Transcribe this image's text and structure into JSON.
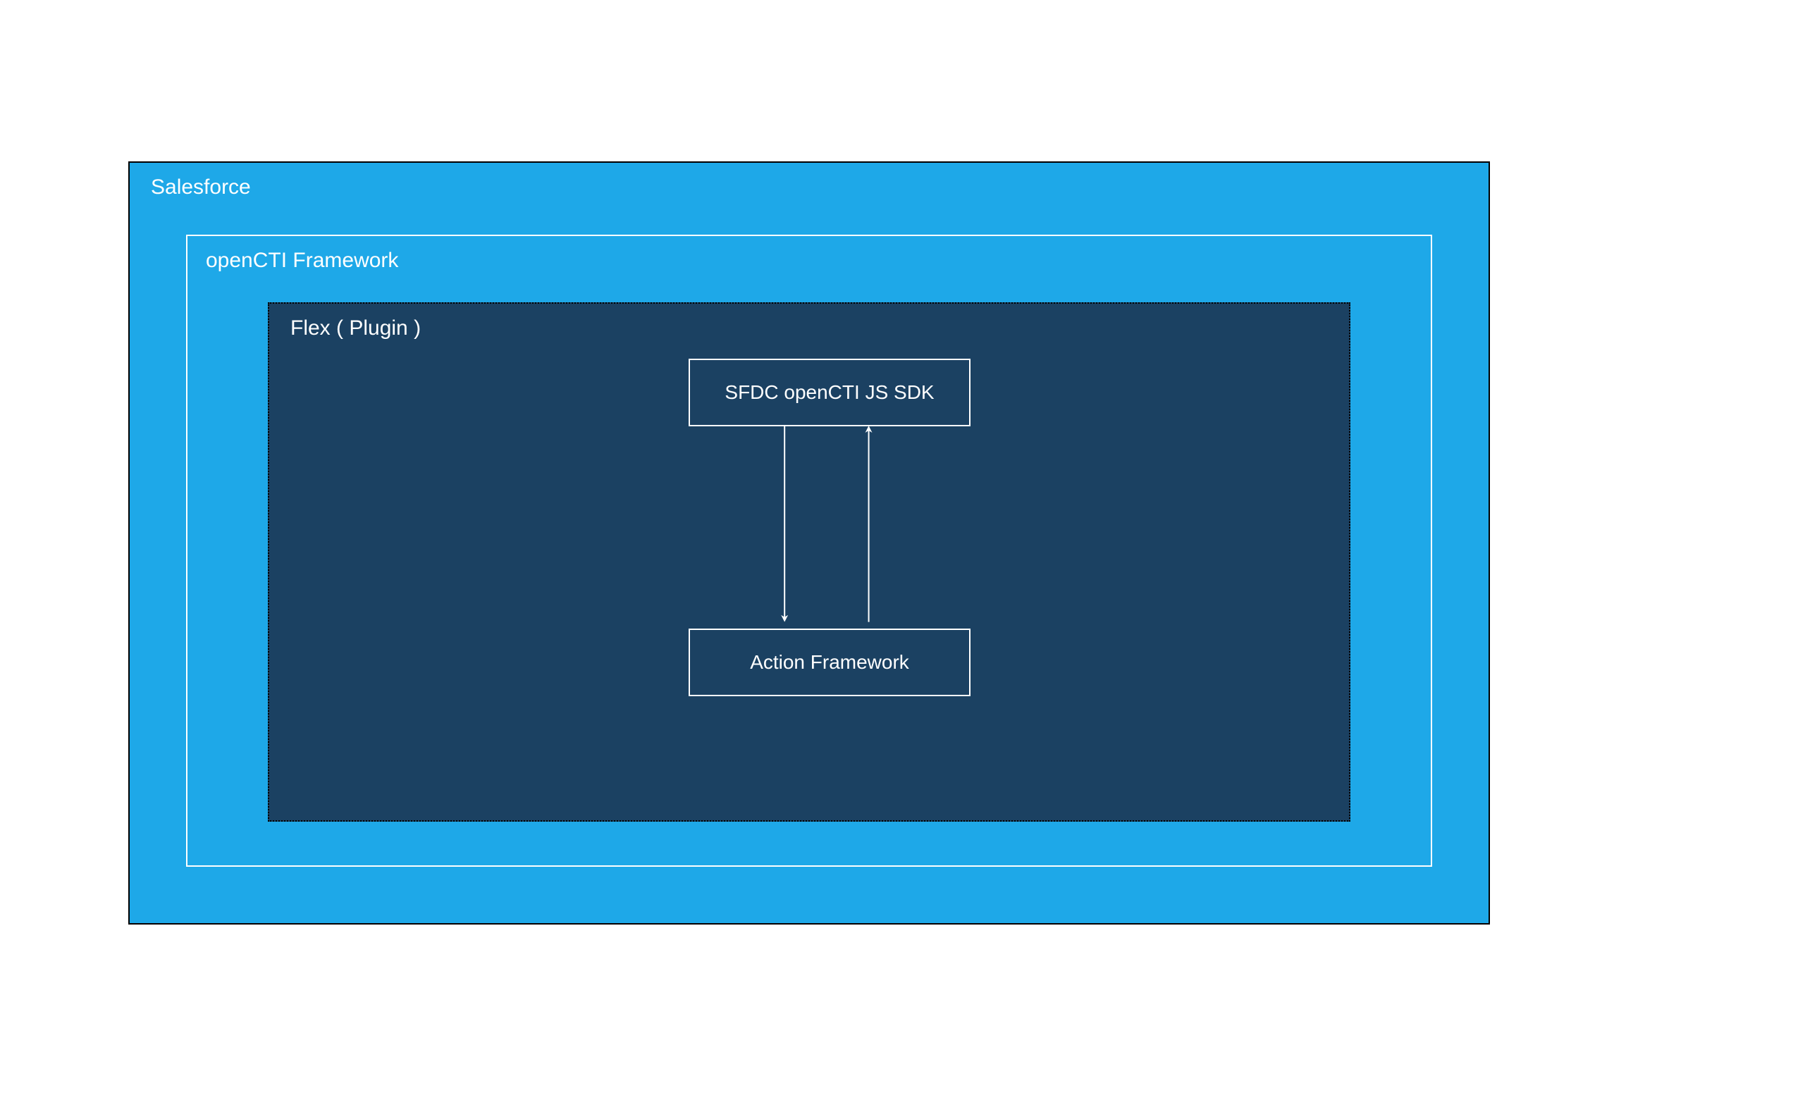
{
  "outer": {
    "label": "Salesforce"
  },
  "middle": {
    "label": "openCTI Framework"
  },
  "inner": {
    "label": "Flex ( Plugin )"
  },
  "boxes": {
    "sdk": "SFDC openCTI JS SDK",
    "action": "Action Framework"
  }
}
